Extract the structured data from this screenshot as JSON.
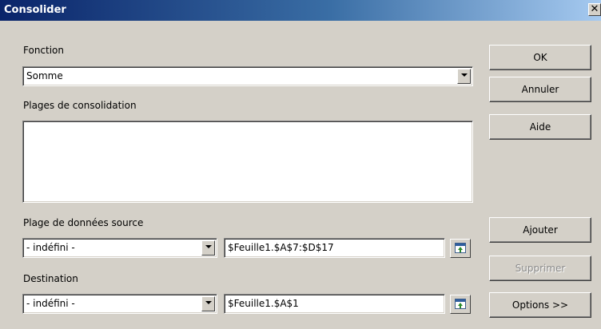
{
  "window": {
    "title": "Consolider",
    "close_glyph": "✕"
  },
  "function_label": "Fonction",
  "function_value": "Somme",
  "ranges_label": "Plages de consolidation",
  "source": {
    "label": "Plage de données source",
    "dropdown_value": "- indéfini -",
    "range_value": "$Feuille1.$A$7:$D$17"
  },
  "destination": {
    "label": "Destination",
    "dropdown_value": "- indéfini -",
    "range_value": "$Feuille1.$A$1"
  },
  "buttons": {
    "ok": "OK",
    "cancel": "Annuler",
    "help": "Aide",
    "add": "Ajouter",
    "remove": "Supprimer",
    "options": "Options >>"
  },
  "icons": {
    "close": "close-icon",
    "dropdown": "chevron-down-icon",
    "shrink": "shrink-dialog-icon"
  },
  "colors": {
    "titlebar_start": "#0a246a",
    "titlebar_end": "#a6caf0",
    "dialog_bg": "#d4d0c8"
  }
}
